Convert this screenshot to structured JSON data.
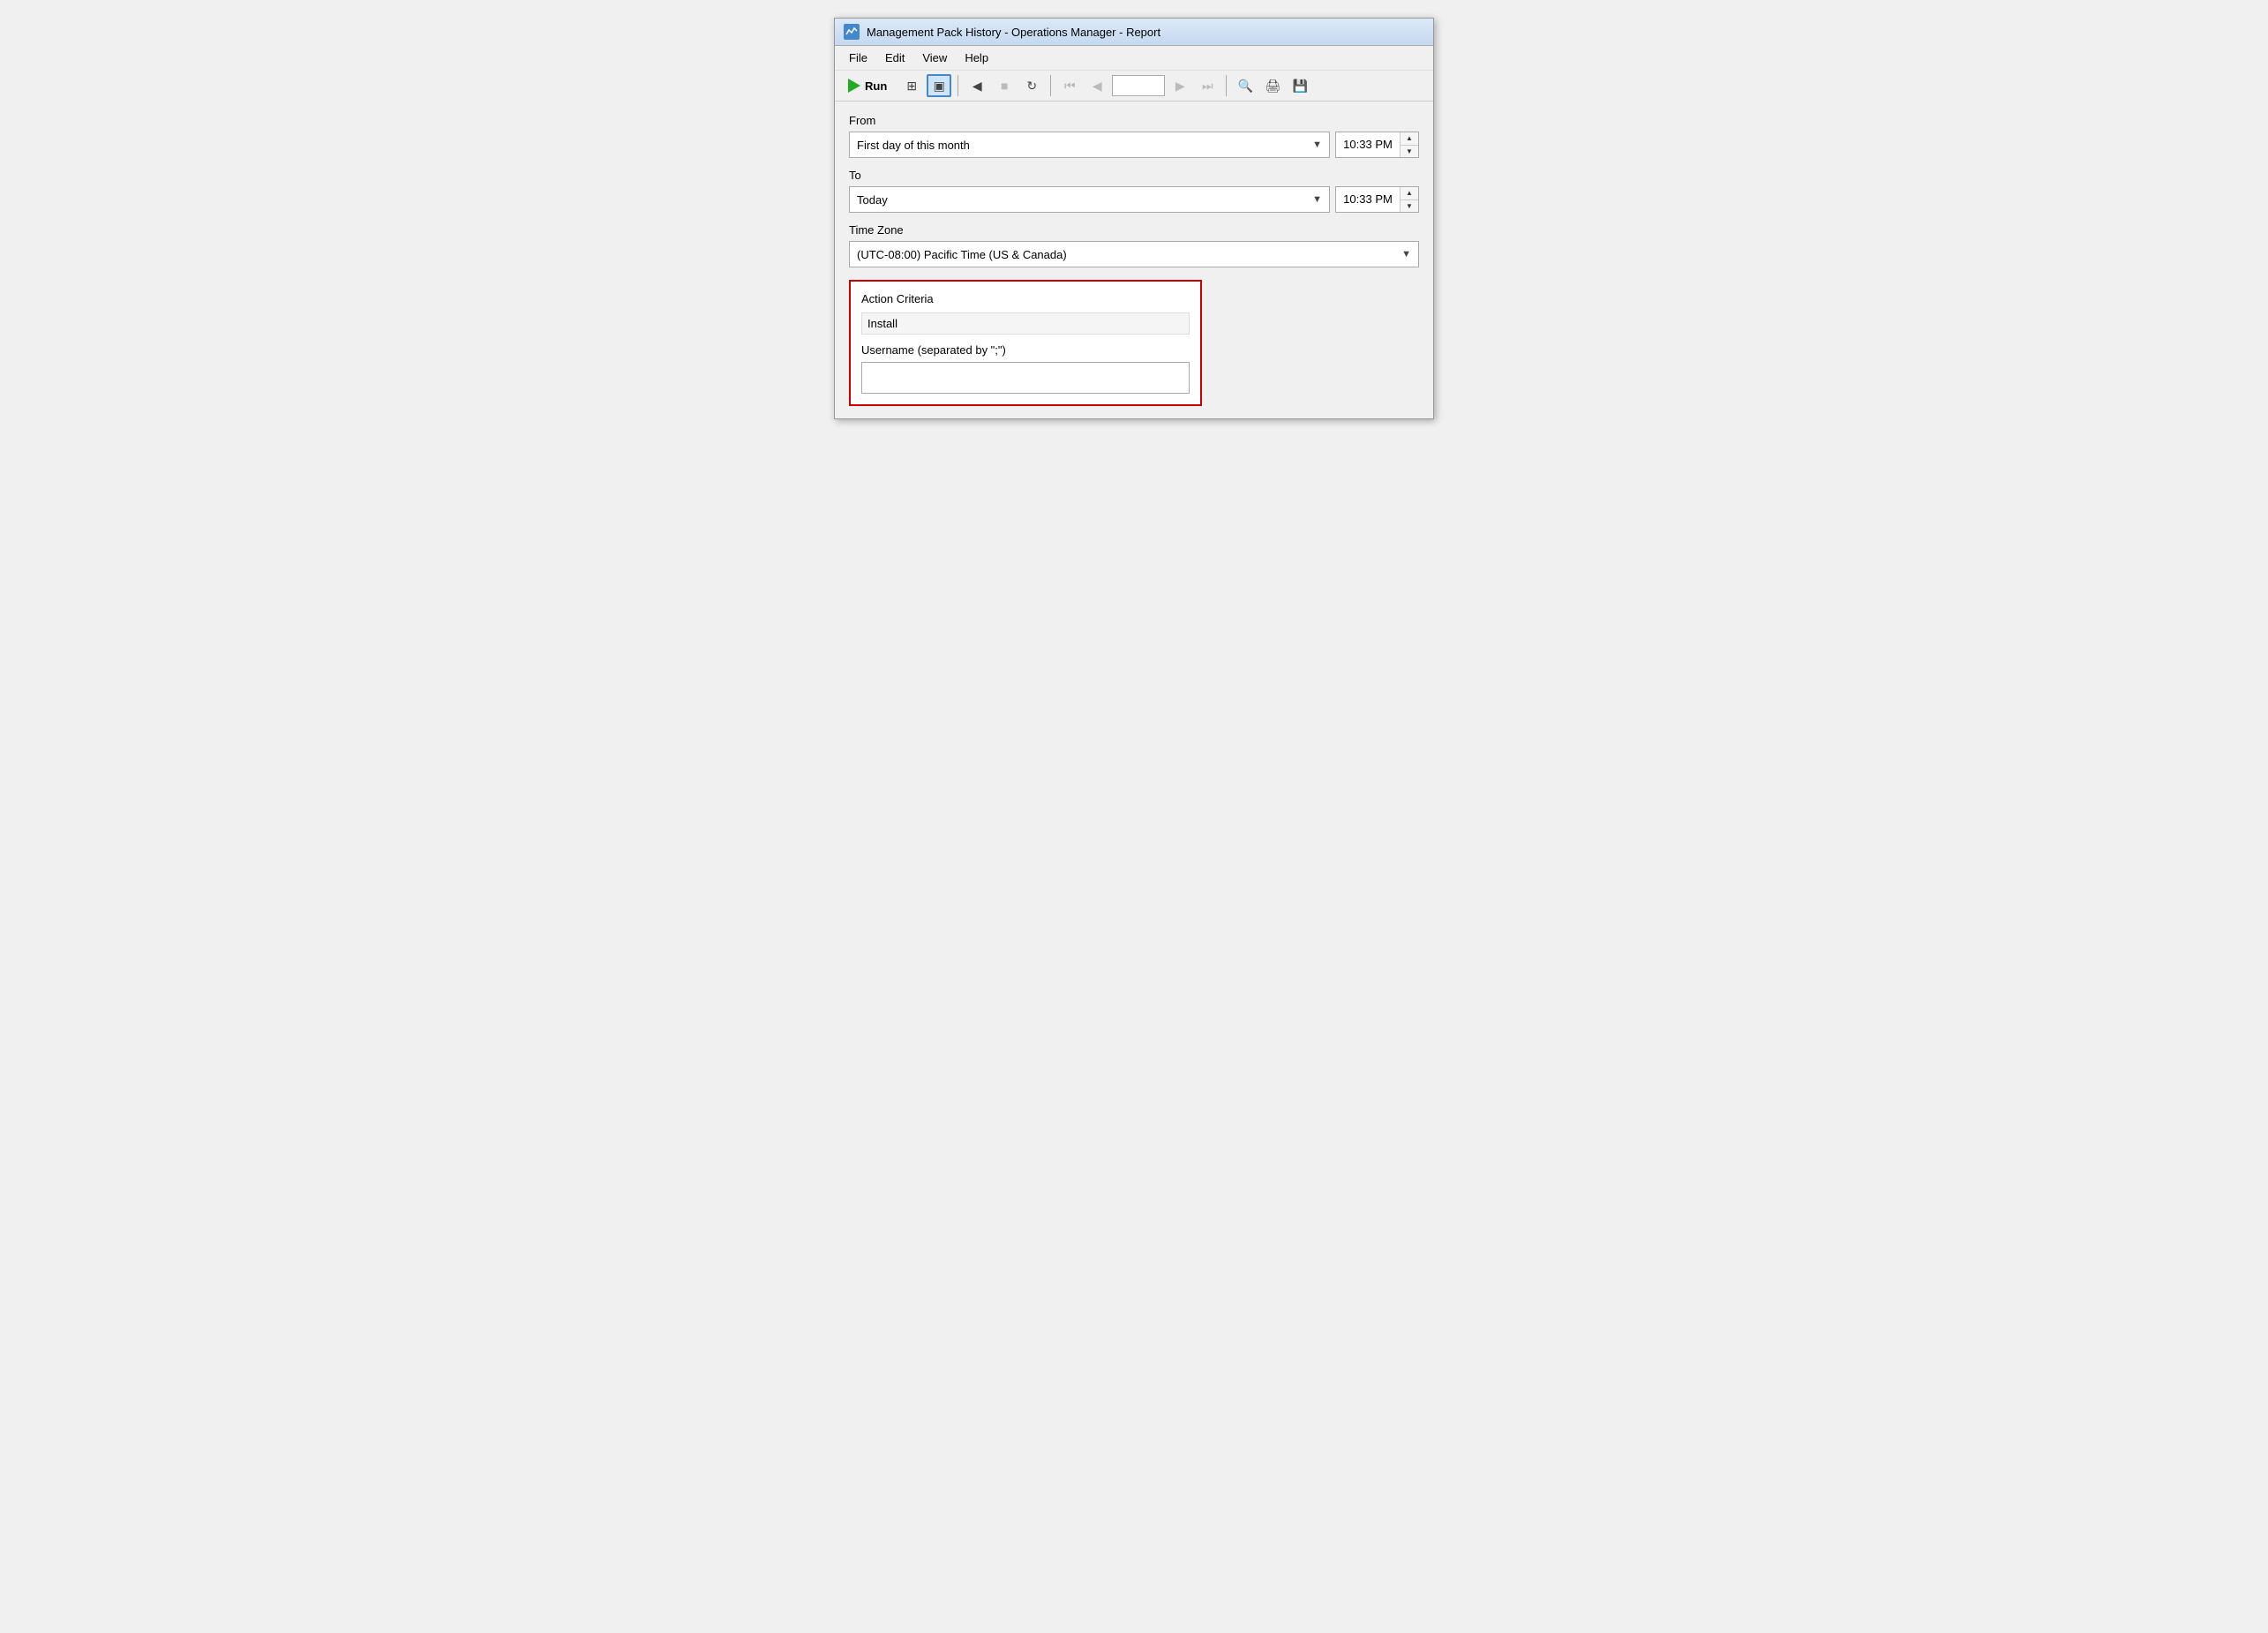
{
  "window": {
    "title": "Management Pack History - Operations Manager - Report",
    "icon": "wave-icon"
  },
  "menu": {
    "items": [
      "File",
      "Edit",
      "View",
      "Help"
    ]
  },
  "toolbar": {
    "run_label": "Run",
    "page_value": "",
    "buttons": [
      {
        "name": "grid-view-btn",
        "icon": "▦",
        "active": false
      },
      {
        "name": "page-view-btn",
        "icon": "▣",
        "active": true
      },
      {
        "name": "back-btn",
        "icon": "◀",
        "active": false
      },
      {
        "name": "stop-btn",
        "icon": "■",
        "active": false
      },
      {
        "name": "refresh-btn",
        "icon": "↻",
        "active": false
      },
      {
        "name": "first-btn",
        "icon": "⏮",
        "active": false
      },
      {
        "name": "prev-btn",
        "icon": "◀",
        "active": false
      },
      {
        "name": "next-btn",
        "icon": "▶",
        "active": false
      },
      {
        "name": "last-btn",
        "icon": "⏭",
        "active": false
      },
      {
        "name": "zoom-btn",
        "icon": "🔍",
        "active": false
      },
      {
        "name": "print-btn",
        "icon": "🖨",
        "active": false
      },
      {
        "name": "export-btn",
        "icon": "💾",
        "active": false
      }
    ]
  },
  "form": {
    "from_label": "From",
    "from_dropdown_value": "First day of this month",
    "from_time": "10:33 PM",
    "to_label": "To",
    "to_dropdown_value": "Today",
    "to_time": "10:33 PM",
    "timezone_label": "Time Zone",
    "timezone_value": "(UTC-08:00) Pacific Time (US & Canada)"
  },
  "criteria": {
    "section_label": "Action Criteria",
    "action_value": "Install",
    "username_label": "Username (separated by \";\")",
    "username_value": "",
    "username_placeholder": ""
  }
}
